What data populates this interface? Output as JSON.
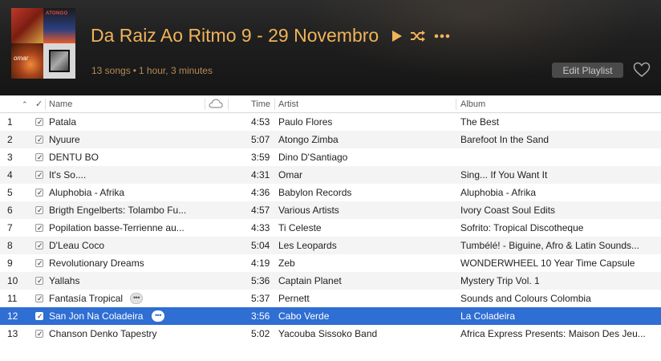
{
  "playlist": {
    "title": "Da Raiz Ao Ritmo 9 - 29 Novembro",
    "song_count": "13 songs",
    "separator": "•",
    "duration": "1 hour, 3 minutes",
    "edit_label": "Edit Playlist",
    "artwork_labels": {
      "top_right": "ATONGO",
      "bottom_left": "omar"
    },
    "accent_color": "#f0b35a"
  },
  "columns": {
    "check": "✓",
    "name": "Name",
    "time": "Time",
    "artist": "Artist",
    "album": "Album"
  },
  "tracks": [
    {
      "num": "1",
      "name": "Patala",
      "time": "4:53",
      "artist": "Paulo Flores",
      "album": "The Best"
    },
    {
      "num": "2",
      "name": "Nyuure",
      "time": "5:07",
      "artist": "Atongo Zimba",
      "album": "Barefoot In the Sand"
    },
    {
      "num": "3",
      "name": "DENTU BO",
      "time": "3:59",
      "artist": "Dino D'Santiago",
      "album": ""
    },
    {
      "num": "4",
      "name": "It's So....",
      "time": "4:31",
      "artist": "Omar",
      "album": "Sing... If You Want It"
    },
    {
      "num": "5",
      "name": "Aluphobia - Afrika",
      "time": "4:36",
      "artist": "Babylon Records",
      "album": "Aluphobia - Afrika"
    },
    {
      "num": "6",
      "name": "Brigth Engelberts: Tolambo Fu...",
      "time": "4:57",
      "artist": "Various Artists",
      "album": "Ivory Coast Soul Edits"
    },
    {
      "num": "7",
      "name": "Popilation basse-Terrienne au...",
      "time": "4:33",
      "artist": "Ti Celeste",
      "album": "Sofrito: Tropical Discotheque"
    },
    {
      "num": "8",
      "name": "D'Leau Coco",
      "time": "5:04",
      "artist": "Les Leopards",
      "album": "Tumbélé! -  Biguine, Afro & Latin Sounds..."
    },
    {
      "num": "9",
      "name": "Revolutionary Dreams",
      "time": "4:19",
      "artist": "Zeb",
      "album": "WONDERWHEEL 10 Year Time Capsule"
    },
    {
      "num": "10",
      "name": "Yallahs",
      "time": "5:36",
      "artist": "Captain Planet",
      "album": "Mystery Trip Vol. 1"
    },
    {
      "num": "11",
      "name": "Fantasía Tropical",
      "time": "5:37",
      "artist": "Pernett",
      "album": "Sounds and Colours Colombia"
    },
    {
      "num": "12",
      "name": "San Jon Na Coladeira",
      "time": "3:56",
      "artist": "Cabo Verde",
      "album": "La Coladeira"
    },
    {
      "num": "13",
      "name": "Chanson Denko Tapestry",
      "time": "5:02",
      "artist": "Yacouba Sissoko Band",
      "album": "Africa Express Presents: Maison Des Jeu..."
    }
  ],
  "more_dots": "•••",
  "selected_color": "#2f6ed3"
}
